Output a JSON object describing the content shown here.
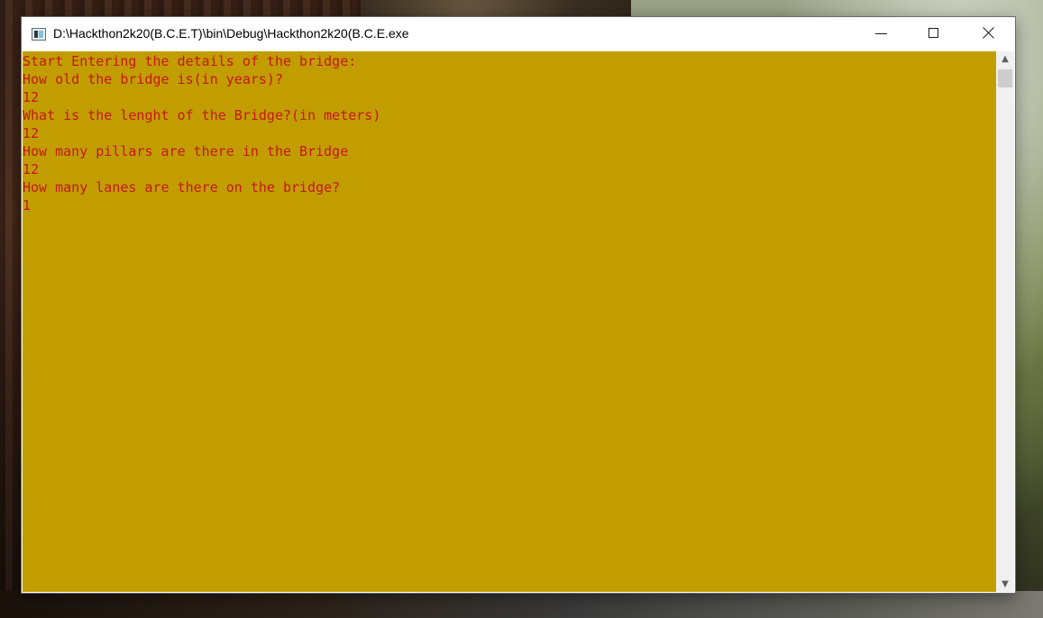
{
  "window": {
    "title": "D:\\Hackthon2k20(B.C.E.T)\\bin\\Debug\\Hackthon2k20(B.C.E.exe",
    "icon": "console-app-icon",
    "buttons": {
      "minimize": "minimize-icon",
      "maximize": "maximize-icon",
      "close": "close-icon"
    }
  },
  "console": {
    "background_color": "#c29d00",
    "text_color": "#c5171b",
    "lines": [
      "Start Entering the details of the bridge:",
      "How old the bridge is(in years)?",
      "12",
      "What is the lenght of the Bridge?(in meters)",
      "12",
      "How many pillars are there in the Bridge",
      "12",
      "How many lanes are there on the bridge?",
      "1"
    ]
  },
  "scrollbar": {
    "up_icon": "chevron-up-icon",
    "down_icon": "chevron-down-icon"
  }
}
